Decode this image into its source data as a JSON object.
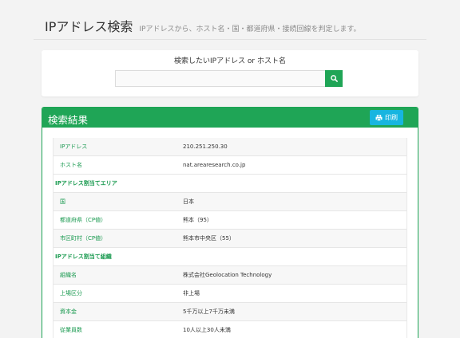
{
  "header": {
    "title": "IPアドレス検索",
    "subtitle": "IPアドレスから、ホスト名・国・都道府県・接続回線を判定します。"
  },
  "search": {
    "label": "検索したいIPアドレス or ホスト名",
    "value": "",
    "placeholder": "",
    "button_icon": "search-icon"
  },
  "result": {
    "title": "検索結果",
    "print_label": "印刷",
    "print_icon": "printer-icon",
    "rows": [
      {
        "type": "data",
        "key": "IPアドレス",
        "value": "210.251.250.30"
      },
      {
        "type": "data",
        "key": "ホスト名",
        "value": "nat.arearesearch.co.jp"
      },
      {
        "type": "section",
        "key": "IPアドレス割当てエリア"
      },
      {
        "type": "data",
        "key": "国",
        "value": "日本"
      },
      {
        "type": "data",
        "key": "都道府県（CP値）",
        "value": "熊本（95）"
      },
      {
        "type": "data",
        "key": "市区町村（CP値）",
        "value": "熊本市中央区（55）"
      },
      {
        "type": "section",
        "key": "IPアドレス割当て組織"
      },
      {
        "type": "data",
        "key": "組織名",
        "value": "株式会社Geolocation Technology",
        "link": true
      },
      {
        "type": "data",
        "key": "上場区分",
        "value": "非上場"
      },
      {
        "type": "data",
        "key": "資本金",
        "value": "5千万以上7千万未満"
      },
      {
        "type": "data",
        "key": "従業員数",
        "value": "10人以上30人未満"
      }
    ]
  },
  "colors": {
    "accent_green": "#1fa556",
    "print_blue": "#17b5e0",
    "link_blue": "#2a7ab8"
  }
}
